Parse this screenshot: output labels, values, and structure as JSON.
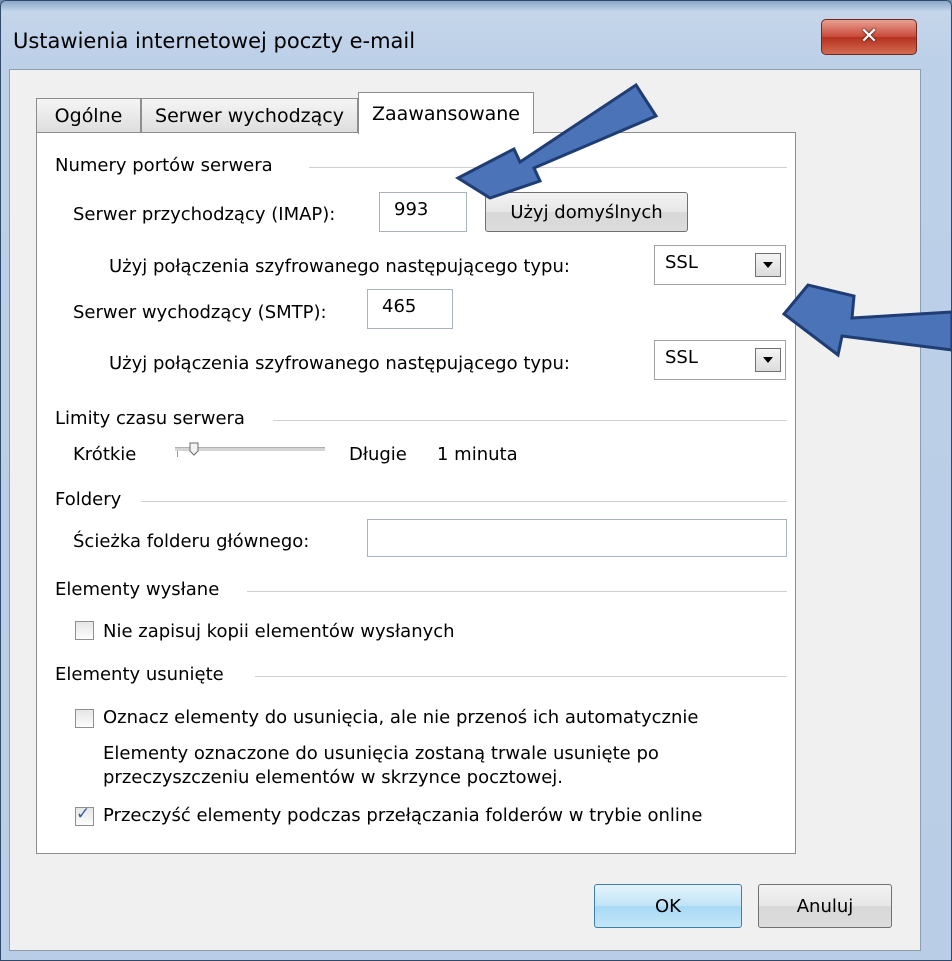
{
  "window": {
    "title": "Ustawienia internetowej poczty e-mail",
    "close_glyph": "✕"
  },
  "tabs": [
    {
      "label": "Ogólne",
      "active": false
    },
    {
      "label": "Serwer wychodzący",
      "active": false
    },
    {
      "label": "Zaawansowane",
      "active": true
    }
  ],
  "ports": {
    "group_label": "Numery portów serwera",
    "incoming_label": "Serwer przychodzący (IMAP):",
    "incoming_value": "993",
    "use_defaults_label": "Użyj domyślnych",
    "encryption_label_1": "Użyj połączenia szyfrowanego następującego typu:",
    "encryption_value_1": "SSL",
    "outgoing_label": "Serwer wychodzący (SMTP):",
    "outgoing_value": "465",
    "encryption_label_2": "Użyj połączenia szyfrowanego następującego typu:",
    "encryption_value_2": "SSL"
  },
  "timeouts": {
    "group_label": "Limity czasu serwera",
    "short_label": "Krótkie",
    "long_label": "Długie",
    "value_label": "1 minuta",
    "slider_level": 0.1
  },
  "folders": {
    "group_label": "Foldery",
    "root_path_label": "Ścieżka folderu głównego:",
    "root_path_value": ""
  },
  "sent_items": {
    "group_label": "Elementy wysłane",
    "dont_save_label": "Nie zapisuj kopii elementów wysłanych",
    "dont_save_checked": false
  },
  "deleted_items": {
    "group_label": "Elementy usunięte",
    "mark_label": "Oznacz elementy do usunięcia, ale nie przenoś ich automatycznie",
    "mark_checked": false,
    "note_line1": "Elementy oznaczone do usunięcia zostaną trwale usunięte po",
    "note_line2": "przeczyszczeniu elementów w skrzynce pocztowej.",
    "purge_label": "Przeczyść elementy podczas przełączania folderów w trybie online",
    "purge_checked": true,
    "check_glyph": "✓"
  },
  "footer": {
    "ok_label": "OK",
    "cancel_label": "Anuluj"
  },
  "colors": {
    "annotation_arrow": "#4a73b8",
    "annotation_arrow_outline": "#1f3d73",
    "accent_button": "#bfe3f7"
  }
}
